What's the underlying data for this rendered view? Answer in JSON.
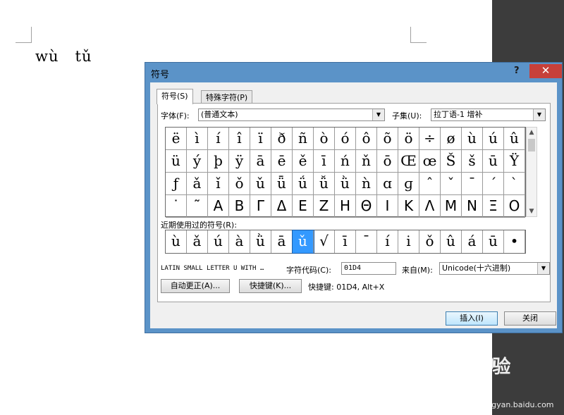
{
  "document": {
    "text": "wù   tǔ"
  },
  "dialog": {
    "title": "符号",
    "help_label": "?",
    "close_label": "✕",
    "tabs": [
      {
        "label": "符号(S)"
      },
      {
        "label": "特殊字符(P)"
      }
    ],
    "font_label": "字体(F):",
    "font_value": "(普通文本)",
    "subset_label": "子集(U):",
    "subset_value": "拉丁语-1 增补",
    "grid_rows": [
      [
        "ë",
        "ì",
        "í",
        "î",
        "ï",
        "ð",
        "ñ",
        "ò",
        "ó",
        "ô",
        "õ",
        "ö",
        "÷",
        "ø",
        "ù",
        "ú",
        "û"
      ],
      [
        "ü",
        "ý",
        "þ",
        "ÿ",
        "ā",
        "ē",
        "ě",
        "ī",
        "ń",
        "ň",
        "ō",
        "Œ",
        "œ",
        "Š",
        "š",
        "ū",
        "Ÿ"
      ],
      [
        "ƒ",
        "ǎ",
        "ǐ",
        "ǒ",
        "ǔ",
        "ǖ",
        "ǘ",
        "ǚ",
        "ǜ",
        "ǹ",
        "ɑ",
        "ɡ",
        "ˆ",
        "ˇ",
        "ˉ",
        "ˊ",
        "ˋ"
      ],
      [
        "˙",
        "˜",
        "Α",
        "Β",
        "Γ",
        "Δ",
        "Ε",
        "Ζ",
        "Η",
        "Θ",
        "Ι",
        "Κ",
        "Λ",
        "Μ",
        "Ν",
        "Ξ",
        "Ο"
      ]
    ],
    "recent_label": "近期使用过的符号(R):",
    "recent": [
      "ù",
      "ǎ",
      "ú",
      "à",
      "ǜ",
      "ā",
      "ǔ",
      "√",
      "ī",
      "¯",
      "í",
      "i",
      "ǒ",
      "û",
      "á",
      "ū",
      "•"
    ],
    "recent_selected_index": 6,
    "char_name": "LATIN SMALL LETTER U WITH …",
    "code_label": "字符代码(C):",
    "code_value": "01D4",
    "from_label": "来自(M):",
    "from_value": "Unicode(十六进制)",
    "autocorrect_label": "自动更正(A)...",
    "shortcut_key_label": "快捷键(K)...",
    "shortcut_info": "快捷键: 01D4, Alt+X",
    "insert_label": "插入(I)",
    "close_button_label": "关闭"
  },
  "watermark": {
    "brand": "Bai 经验",
    "url": "jingyan.baidu.com"
  }
}
